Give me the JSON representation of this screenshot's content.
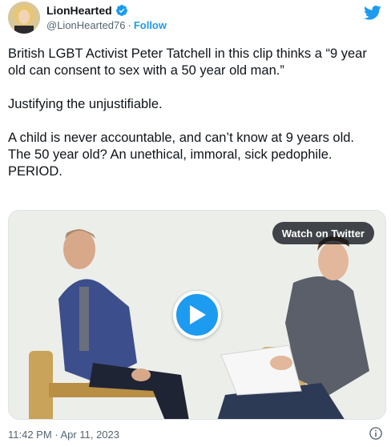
{
  "author": {
    "display_name": "LionHearted",
    "handle": "@LionHearted76",
    "separator": "·",
    "follow_label": "Follow"
  },
  "tweet": {
    "paragraphs": [
      "British LGBT Activist Peter Tatchell in this clip thinks a “9 year old can consent to sex with a 50 year old man.”",
      "Justifying the unjustifiable.",
      "A child is never accountable, and can’t know at 9 years old.\nThe 50 year old? An unethical, immoral, sick pedophile. PERIOD."
    ]
  },
  "media": {
    "watch_label": "Watch on Twitter"
  },
  "footer": {
    "timestamp": "11:42 PM · Apr 11, 2023"
  },
  "colors": {
    "accent": "#1d9bf0",
    "text": "#0f1419",
    "secondary": "#536471"
  },
  "icons": {
    "verified": "verified-badge-icon",
    "brand": "twitter-bird-icon",
    "play": "play-icon",
    "info": "info-icon"
  }
}
